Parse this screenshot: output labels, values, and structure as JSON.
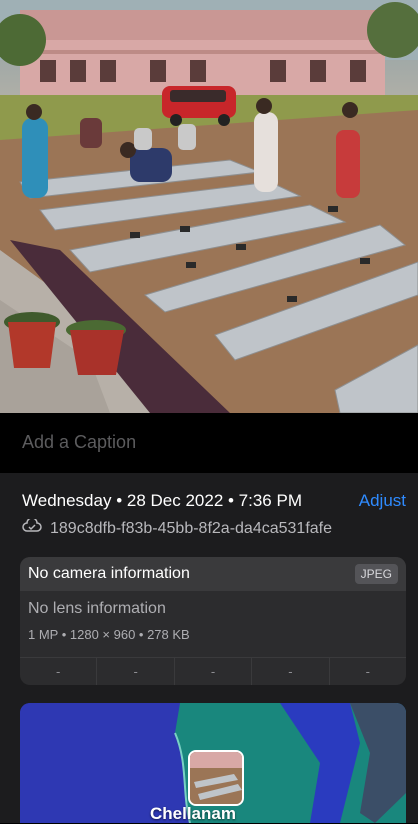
{
  "caption": {
    "placeholder": "Add a Caption"
  },
  "details": {
    "datetime": "Wednesday • 28 Dec 2022 • 7:36 PM",
    "adjust_label": "Adjust",
    "filename": "189c8dfb-f83b-45bb-8f2a-da4ca531fafe"
  },
  "camera": {
    "title": "No camera information",
    "format_badge": "JPEG",
    "lens": "No lens information",
    "meta": "1 MP • 1280 × 960 • 278 KB",
    "exif": [
      "-",
      "-",
      "-",
      "-",
      "-"
    ]
  },
  "map": {
    "location": "Chellanam"
  },
  "icons": {
    "cloud": "cloud-check-icon"
  }
}
